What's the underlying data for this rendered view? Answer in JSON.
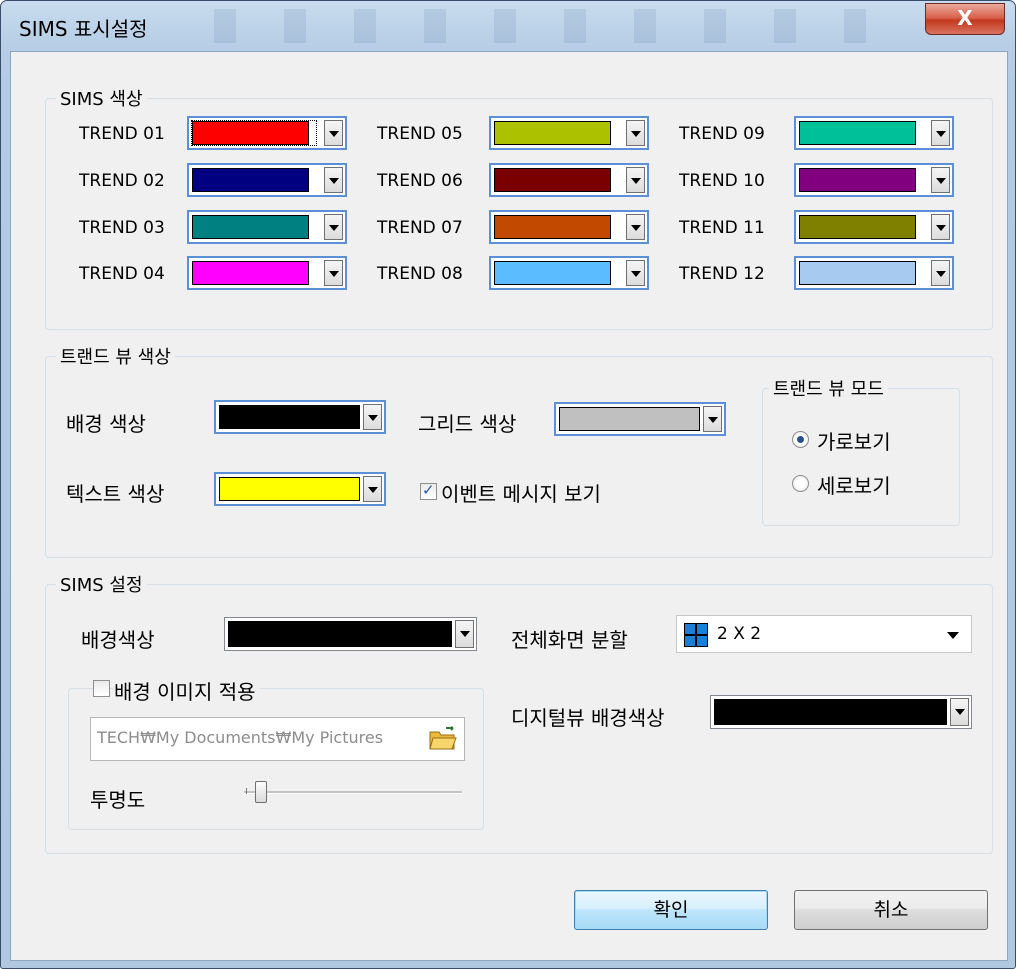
{
  "window": {
    "title": "SIMS 표시설정",
    "close_label": "X"
  },
  "sims_colors": {
    "label": "SIMS 색상",
    "trends": [
      {
        "label": "TREND 01",
        "color": "#ff0000"
      },
      {
        "label": "TREND 02",
        "color": "#000080"
      },
      {
        "label": "TREND 03",
        "color": "#008080"
      },
      {
        "label": "TREND 04",
        "color": "#ff00ff"
      },
      {
        "label": "TREND 05",
        "color": "#acc200"
      },
      {
        "label": "TREND 06",
        "color": "#7a0000"
      },
      {
        "label": "TREND 07",
        "color": "#c24a00"
      },
      {
        "label": "TREND 08",
        "color": "#5bbcff"
      },
      {
        "label": "TREND 09",
        "color": "#00c09a"
      },
      {
        "label": "TREND 10",
        "color": "#800080"
      },
      {
        "label": "TREND 11",
        "color": "#808000"
      },
      {
        "label": "TREND 12",
        "color": "#a6caf0"
      }
    ]
  },
  "trend_view": {
    "label": "트랜드 뷰 색상",
    "bg_color_label": "배경 색상",
    "bg_color": "#000000",
    "grid_color_label": "그리드 색상",
    "grid_color": "#c0c0c0",
    "text_color_label": "텍스트 색상",
    "text_color": "#ffff00",
    "event_msg_label": "이벤트 메시지 보기",
    "event_msg_checked": true,
    "mode": {
      "label": "트랜드 뷰 모드",
      "horizontal_label": "가로보기",
      "vertical_label": "세로보기",
      "selected": "horizontal"
    }
  },
  "sims_settings": {
    "label": "SIMS 설정",
    "bg_color_label": "배경색상",
    "bg_color": "#000000",
    "split_label": "전체화면 분할",
    "split_value": "2 X 2",
    "digital_bg_label": "디지털뷰 배경색상",
    "digital_bg_color": "#000000",
    "bg_image": {
      "label": "배경 이미지 적용",
      "checked": false,
      "path": "TECH₩My Documents₩My Pictures",
      "transparency_label": "투명도",
      "transparency": 0.05
    }
  },
  "buttons": {
    "ok": "확인",
    "cancel": "취소"
  }
}
